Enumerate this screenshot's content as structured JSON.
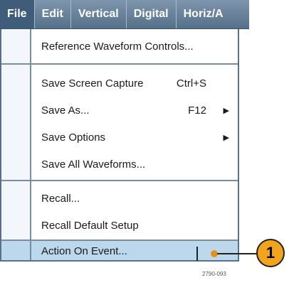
{
  "menubar": {
    "items": [
      {
        "label": "File"
      },
      {
        "label": "Edit"
      },
      {
        "label": "Vertical"
      },
      {
        "label": "Digital"
      },
      {
        "label": "Horiz/A"
      }
    ]
  },
  "file_menu": {
    "items": [
      {
        "label": "Reference Waveform Controls..."
      },
      {
        "label": "Save Screen Capture",
        "shortcut": "Ctrl+S"
      },
      {
        "label": "Save As...",
        "shortcut": "F12",
        "submenu": "▶"
      },
      {
        "label": "Save Options",
        "submenu": "▶"
      },
      {
        "label": "Save All Waveforms..."
      },
      {
        "label": "Recall..."
      },
      {
        "label": "Recall Default Setup"
      },
      {
        "label": "Action On Event..."
      }
    ]
  },
  "callout": {
    "number": "1"
  },
  "figure_ref": "2790-093",
  "colors": {
    "menubar": "#55708a",
    "highlight": "#bcd8ec",
    "callout": "#f2a41e"
  }
}
